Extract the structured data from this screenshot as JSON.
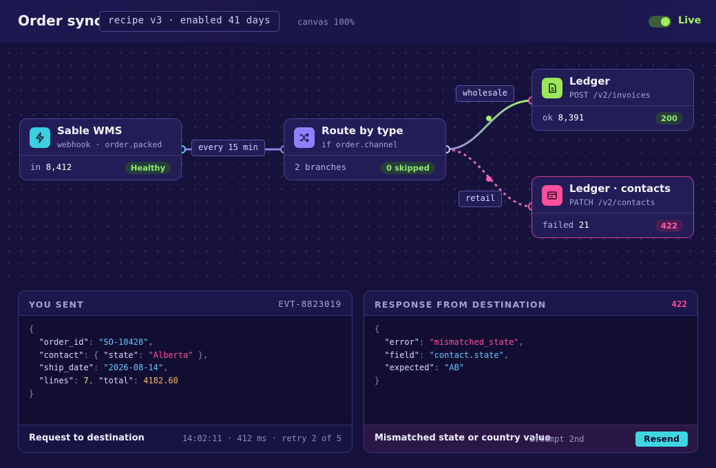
{
  "header": {
    "title": "Order sync",
    "recipe": "recipe v3 · enabled 41 days",
    "zoom": "canvas 100%",
    "live_label": "Live",
    "live_on": true
  },
  "nodes": {
    "source": {
      "name": "Sable WMS",
      "sub": "webhook · order.packed",
      "stat_label": "in",
      "stat_value": "8,412",
      "badge": "Healthy",
      "icon": "lightning-icon"
    },
    "router": {
      "name": "Route by type",
      "sub": "if order.channel",
      "stat_label": "2 branches",
      "badge": "0 skipped",
      "icon": "shuffle-icon"
    },
    "ledger": {
      "name": "Ledger",
      "sub": "POST /v2/invoices",
      "stat_label": "ok",
      "stat_value": "8,391",
      "badge": "200",
      "icon": "document-icon"
    },
    "contacts": {
      "name": "Ledger · contacts",
      "sub": "PATCH /v2/contacts",
      "stat_label": "failed",
      "stat_value": "21",
      "badge": "422",
      "icon": "card-icon"
    }
  },
  "edges": {
    "schedule": "every 15 min",
    "wholesale": "wholesale",
    "retail": "retail"
  },
  "sent_panel": {
    "title": "YOU SENT",
    "event_id": "EVT-8823019",
    "order_id": "\"SO-10428\"",
    "state": "\"Alberta\"",
    "ship_date": "\"2026-08-14\"",
    "lines": "7",
    "total": "4182.60",
    "footer": "Request to destination",
    "footer_meta": "14:02:11 · 412 ms · retry 2 of 5"
  },
  "response_panel": {
    "title": "RESPONSE FROM DESTINATION",
    "status": "422",
    "error": "\"mismatched_state\"",
    "field": "\"contact.state\"",
    "expected": "\"AB\"",
    "footer": "Mismatched state or country value",
    "attempt": "attempt 2nd",
    "resend_label": "Resend"
  },
  "colors": {
    "accent_green": "#9cef5a",
    "accent_pink": "#ff4f9c",
    "accent_cyan": "#3fd6e3",
    "source_icon_bg": "#3bcfe0",
    "router_icon_bg": "#8f80ff",
    "ledger_icon_bg": "#9be75b",
    "contacts_icon_bg": "#ff4f9c"
  }
}
